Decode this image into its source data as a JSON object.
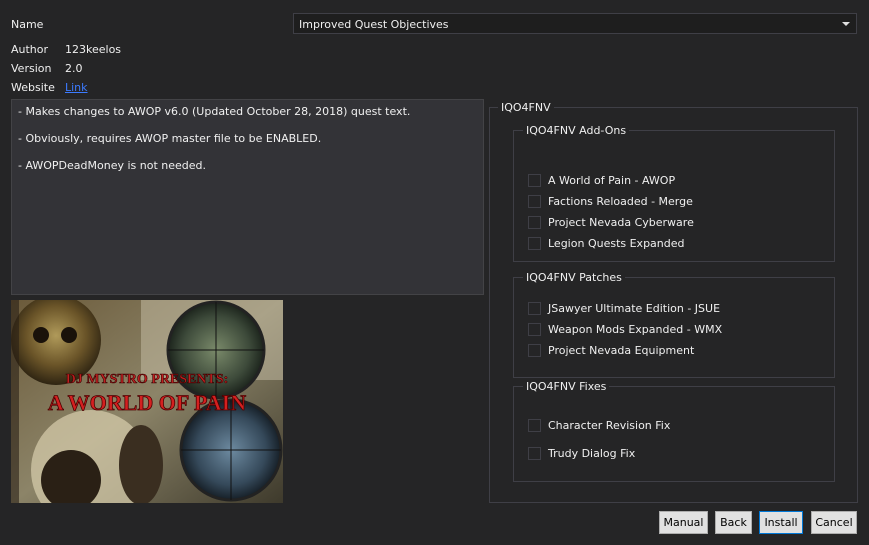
{
  "info": {
    "name_label": "Name",
    "author_label": "Author",
    "author_value": "123keelos",
    "version_label": "Version",
    "version_value": "2.0",
    "website_label": "Website",
    "website_link": "Link"
  },
  "name_select": {
    "value": "Improved Quest Objectives"
  },
  "description": {
    "lines": [
      "- Makes changes to AWOP v6.0 (Updated October 28, 2018) quest text.",
      "- Obviously, requires AWOP master file to be ENABLED.",
      "- AWOPDeadMoney is not needed."
    ]
  },
  "preview_image": {
    "line1": "DJ MYSTRO PRESENTS:",
    "line2": "A WORLD OF PAIN"
  },
  "options": {
    "title": "IQO4FNV",
    "groups": [
      {
        "title": "IQO4FNV Add-Ons",
        "items": [
          {
            "label": "A World of Pain - AWOP",
            "checked": false
          },
          {
            "label": "Factions Reloaded - Merge",
            "checked": false
          },
          {
            "label": "Project Nevada Cyberware",
            "checked": false
          },
          {
            "label": "Legion Quests Expanded",
            "checked": false
          }
        ]
      },
      {
        "title": "IQO4FNV Patches",
        "items": [
          {
            "label": "JSawyer Ultimate Edition - JSUE",
            "checked": false
          },
          {
            "label": "Weapon Mods Expanded - WMX",
            "checked": false
          },
          {
            "label": "Project Nevada Equipment",
            "checked": false
          }
        ]
      },
      {
        "title": "IQO4FNV Fixes",
        "items": [
          {
            "label": "Character Revision Fix",
            "checked": false
          },
          {
            "label": "Trudy Dialog Fix",
            "checked": false
          }
        ]
      }
    ]
  },
  "buttons": {
    "manual": "Manual",
    "back": "Back",
    "install": "Install",
    "cancel": "Cancel"
  },
  "colors": {
    "background": "#252526",
    "panel": "#333337",
    "border": "#3f3f46",
    "link": "#3c7bff",
    "default_button_border": "#0078d7"
  }
}
